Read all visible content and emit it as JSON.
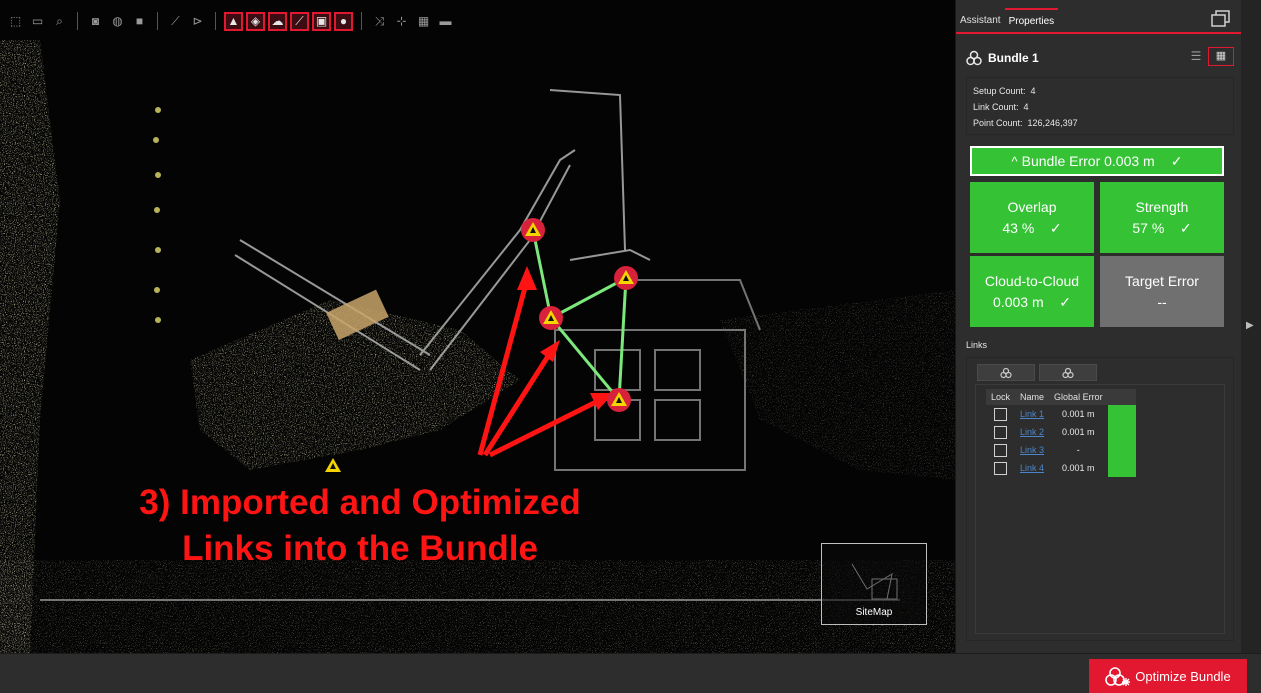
{
  "toolbar": {
    "groups": [
      [
        "select-icon",
        "select-multiple-icon",
        "zoom-fit-icon"
      ],
      [
        "camera-icon",
        "scan-setup-icon",
        "square-icon"
      ],
      [
        "measure-icon",
        "pick-icon"
      ],
      [
        "target-icon",
        "tag-icon",
        "cloud-icon",
        "measure-distance-icon",
        "image-icon",
        "location-pin-icon"
      ],
      [
        "shuffle-icon",
        "add-point-icon",
        "export-image-icon",
        "display-mode-icon"
      ]
    ],
    "active": [
      "target-icon",
      "tag-icon",
      "cloud-icon",
      "measure-distance-icon",
      "image-icon",
      "location-pin-icon"
    ]
  },
  "viewport": {
    "annotation_lines": [
      "3) Imported and Optimized",
      "Links into the Bundle"
    ],
    "sitemap_label": "SiteMap"
  },
  "panel": {
    "tabs": [
      {
        "label": "Assistant"
      },
      {
        "label": "Properties"
      }
    ],
    "bundle_title": "Bundle 1",
    "stats": [
      {
        "label": "Setup Count:",
        "value": "4"
      },
      {
        "label": "Link Count:",
        "value": "4"
      },
      {
        "label": "Point Count:",
        "value": "126,246,397"
      }
    ],
    "bundle_error": {
      "caret": "^",
      "label": "Bundle Error 0.003 m",
      "check": "✓",
      "color": "#35c235"
    },
    "metrics": {
      "overlap": {
        "title": "Overlap",
        "value": "43 %",
        "check": "✓"
      },
      "strength": {
        "title": "Strength",
        "value": "57 %",
        "check": "✓"
      },
      "c2c": {
        "title": "Cloud-to-Cloud",
        "value": "0.003 m",
        "check": "✓"
      },
      "target": {
        "title": "Target Error",
        "value": "--"
      }
    },
    "links_label": "Links",
    "links_table": {
      "headers": [
        "Lock",
        "Name",
        "Global Error"
      ],
      "rows": [
        {
          "name": "Link 1",
          "error": "0.001 m",
          "status": "#35c235"
        },
        {
          "name": "Link 2",
          "error": "0.001 m",
          "status": "#35c235"
        },
        {
          "name": "Link 3",
          "error": "-",
          "status": "#35c235"
        },
        {
          "name": "Link 4",
          "error": "0.001 m",
          "status": "#35c235"
        }
      ]
    }
  },
  "bottom": {
    "optimize_label": "Optimize Bundle"
  },
  "colors": {
    "accent": "#e1182f",
    "ok_green": "#35c235",
    "link_line": "#7ce87c",
    "annotation_red": "#ff1414",
    "target_yellow": "#f5d400"
  }
}
